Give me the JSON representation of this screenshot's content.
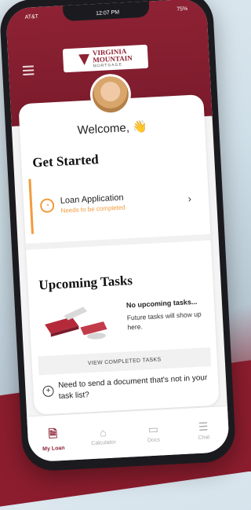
{
  "status": {
    "left": "AT&T",
    "time": "12:07 PM",
    "right": "75%"
  },
  "logo": {
    "line1": "VIRGINIA",
    "line2": "MOUNTAIN",
    "line3": "MORTGAGE"
  },
  "welcome": "Welcome,",
  "welcome_emoji": "👋",
  "get_started": {
    "title": "Get Started",
    "task": {
      "title": "Loan Application",
      "status": "Needs to be completed"
    }
  },
  "upcoming": {
    "title": "Upcoming Tasks",
    "empty_title": "No upcoming tasks...",
    "empty_desc": "Future tasks will show up here.",
    "view_completed": "VIEW COMPLETED TASKS",
    "need_doc": "Need to send a document that's not in your task list?"
  },
  "tabs": [
    {
      "label": "My Loan",
      "icon": "document-icon"
    },
    {
      "label": "Calculator",
      "icon": "home-icon"
    },
    {
      "label": "Docs",
      "icon": "folder-icon"
    },
    {
      "label": "Chat",
      "icon": "chat-icon"
    }
  ],
  "colors": {
    "brand": "#8e2234",
    "accent": "#f29b3b"
  }
}
